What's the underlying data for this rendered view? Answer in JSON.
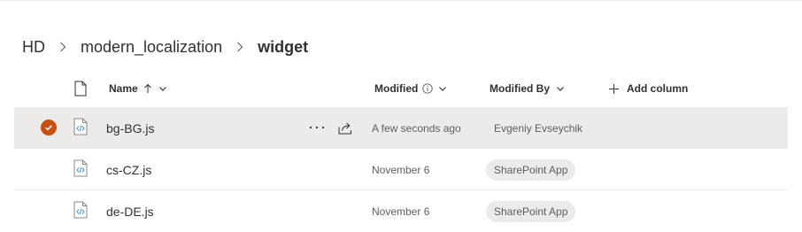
{
  "breadcrumb": {
    "items": [
      "HD",
      "modern_localization"
    ],
    "current": "widget"
  },
  "columns": {
    "name": "Name",
    "modified": "Modified",
    "modified_by": "Modified By",
    "add_column": "Add column"
  },
  "sort": {
    "column": "Name",
    "direction": "ascending"
  },
  "files": [
    {
      "name": "bg-BG.js",
      "modified": "A few seconds ago",
      "modified_by": "Evgeniy Evseychik",
      "selected": true
    },
    {
      "name": "cs-CZ.js",
      "modified": "November 6",
      "modified_by": "SharePoint App",
      "selected": false
    },
    {
      "name": "de-DE.js",
      "modified": "November 6",
      "modified_by": "SharePoint App",
      "selected": false
    }
  ],
  "icons": {
    "file_type": "document-icon",
    "sort": "arrow-up-icon",
    "menu": "chevron-down-icon",
    "info": "info-icon",
    "add": "plus-icon",
    "selected": "checkmark-icon",
    "more": "more-icon",
    "share": "share-icon",
    "file": "js-file-icon"
  },
  "colors": {
    "accent": "#ca5010",
    "selected_row": "#edebe9",
    "secondary_text": "#605e5c"
  }
}
